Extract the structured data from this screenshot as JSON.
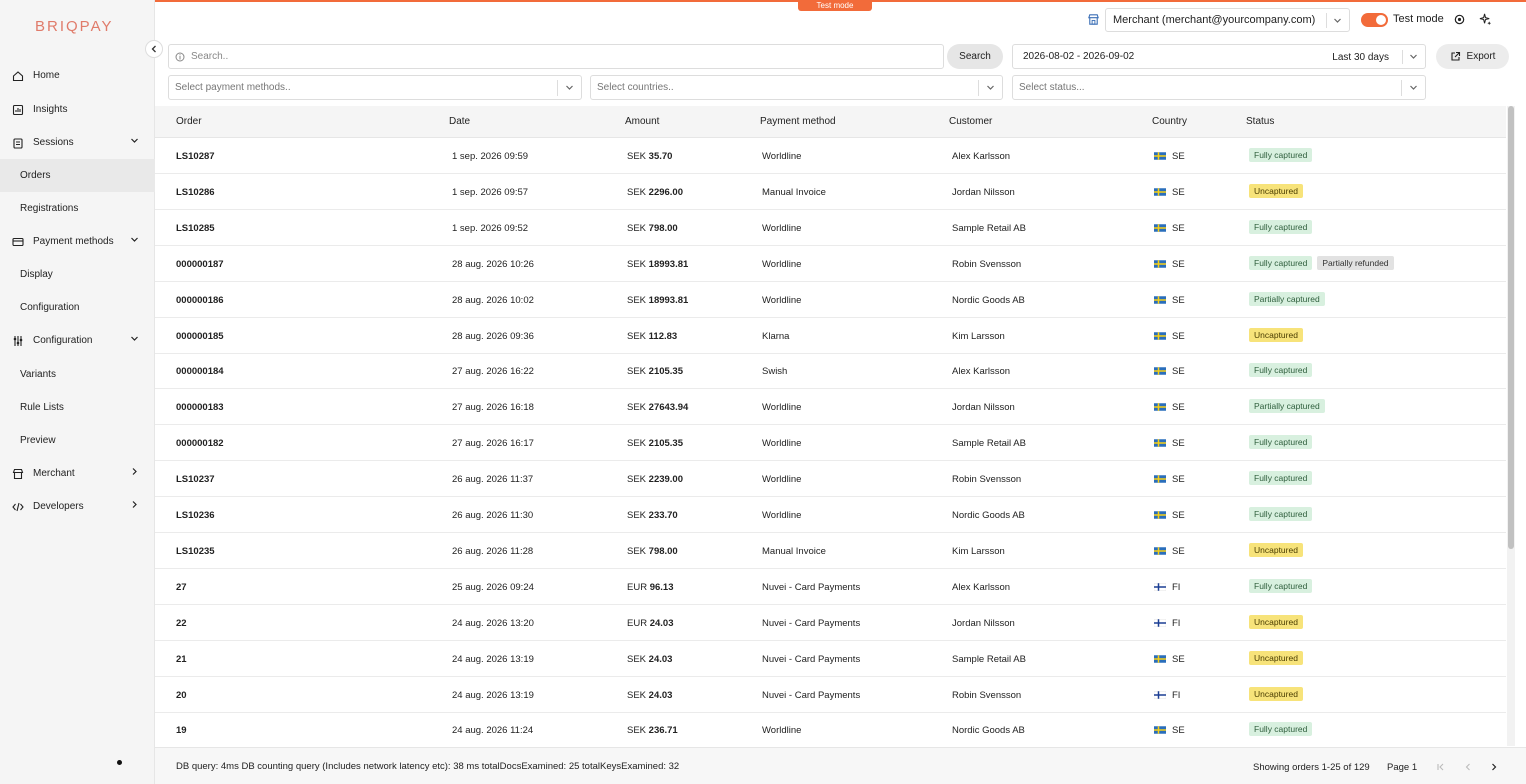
{
  "brand": "BRIQPAY",
  "sidebar": {
    "items": [
      {
        "label": "Home",
        "icon": "home-icon",
        "kind": "top"
      },
      {
        "label": "Insights",
        "icon": "insights-icon",
        "kind": "top"
      },
      {
        "label": "Sessions",
        "icon": "clipboard-icon",
        "kind": "top",
        "chevron": "down"
      },
      {
        "label": "Orders",
        "kind": "sub",
        "active": true
      },
      {
        "label": "Registrations",
        "kind": "sub"
      },
      {
        "label": "Payment methods",
        "icon": "card-icon",
        "kind": "top",
        "chevron": "down"
      },
      {
        "label": "Display",
        "kind": "sub"
      },
      {
        "label": "Configuration",
        "kind": "sub"
      },
      {
        "label": "Configuration",
        "icon": "sliders-icon",
        "kind": "top",
        "chevron": "down"
      },
      {
        "label": "Variants",
        "kind": "sub"
      },
      {
        "label": "Rule Lists",
        "kind": "sub"
      },
      {
        "label": "Preview",
        "kind": "sub"
      },
      {
        "label": "Merchant",
        "icon": "store-icon",
        "kind": "top",
        "chevron": "right"
      },
      {
        "label": "Developers",
        "icon": "code-icon",
        "kind": "top",
        "chevron": "right"
      }
    ]
  },
  "header": {
    "test_tab": "Test mode",
    "merchant": "Merchant (merchant@yourcompany.com)",
    "test_mode_label": "Test mode",
    "accent": "#f26b3a"
  },
  "filters": {
    "search_placeholder": "Search..",
    "search_button": "Search",
    "date_range": "2026-08-02 - 2026-09-02",
    "date_preset": "Last 30 days",
    "export_label": "Export",
    "payment_methods_placeholder": "Select payment methods..",
    "countries_placeholder": "Select countries..",
    "status_placeholder": "Select status..."
  },
  "table": {
    "columns": [
      "Order",
      "Date",
      "Amount",
      "Payment method",
      "Customer",
      "Country",
      "Status"
    ],
    "rows": [
      {
        "order": "LS10287",
        "date": "1 sep. 2026 09:59",
        "currency": "SEK",
        "amount": "35.70",
        "method": "Worldline",
        "customer": "Alex Karlsson",
        "country": "SE",
        "status": [
          {
            "label": "Fully captured",
            "tone": "green"
          }
        ]
      },
      {
        "order": "LS10286",
        "date": "1 sep. 2026 09:57",
        "currency": "SEK",
        "amount": "2296.00",
        "method": "Manual Invoice",
        "customer": "Jordan Nilsson",
        "country": "SE",
        "status": [
          {
            "label": "Uncaptured",
            "tone": "yellow"
          }
        ]
      },
      {
        "order": "LS10285",
        "date": "1 sep. 2026 09:52",
        "currency": "SEK",
        "amount": "798.00",
        "method": "Worldline",
        "customer": "Sample Retail AB",
        "country": "SE",
        "status": [
          {
            "label": "Fully captured",
            "tone": "green"
          }
        ]
      },
      {
        "order": "000000187",
        "date": "28 aug. 2026 10:26",
        "currency": "SEK",
        "amount": "18993.81",
        "method": "Worldline",
        "customer": "Robin Svensson",
        "country": "SE",
        "status": [
          {
            "label": "Fully captured",
            "tone": "green"
          },
          {
            "label": "Partially refunded",
            "tone": "grey"
          }
        ]
      },
      {
        "order": "000000186",
        "date": "28 aug. 2026 10:02",
        "currency": "SEK",
        "amount": "18993.81",
        "method": "Worldline",
        "customer": "Nordic Goods AB",
        "country": "SE",
        "status": [
          {
            "label": "Partially captured",
            "tone": "green"
          }
        ]
      },
      {
        "order": "000000185",
        "date": "28 aug. 2026 09:36",
        "currency": "SEK",
        "amount": "112.83",
        "method": "Klarna",
        "customer": "Kim Larsson",
        "country": "SE",
        "status": [
          {
            "label": "Uncaptured",
            "tone": "yellow"
          }
        ]
      },
      {
        "order": "000000184",
        "date": "27 aug. 2026 16:22",
        "currency": "SEK",
        "amount": "2105.35",
        "method": "Swish",
        "customer": "Alex Karlsson",
        "country": "SE",
        "status": [
          {
            "label": "Fully captured",
            "tone": "green"
          }
        ]
      },
      {
        "order": "000000183",
        "date": "27 aug. 2026 16:18",
        "currency": "SEK",
        "amount": "27643.94",
        "method": "Worldline",
        "customer": "Jordan Nilsson",
        "country": "SE",
        "status": [
          {
            "label": "Partially captured",
            "tone": "green"
          }
        ]
      },
      {
        "order": "000000182",
        "date": "27 aug. 2026 16:17",
        "currency": "SEK",
        "amount": "2105.35",
        "method": "Worldline",
        "customer": "Sample Retail AB",
        "country": "SE",
        "status": [
          {
            "label": "Fully captured",
            "tone": "green"
          }
        ]
      },
      {
        "order": "LS10237",
        "date": "26 aug. 2026 11:37",
        "currency": "SEK",
        "amount": "2239.00",
        "method": "Worldline",
        "customer": "Robin Svensson",
        "country": "SE",
        "status": [
          {
            "label": "Fully captured",
            "tone": "green"
          }
        ]
      },
      {
        "order": "LS10236",
        "date": "26 aug. 2026 11:30",
        "currency": "SEK",
        "amount": "233.70",
        "method": "Worldline",
        "customer": "Nordic Goods AB",
        "country": "SE",
        "status": [
          {
            "label": "Fully captured",
            "tone": "green"
          }
        ]
      },
      {
        "order": "LS10235",
        "date": "26 aug. 2026 11:28",
        "currency": "SEK",
        "amount": "798.00",
        "method": "Manual Invoice",
        "customer": "Kim Larsson",
        "country": "SE",
        "status": [
          {
            "label": "Uncaptured",
            "tone": "yellow"
          }
        ]
      },
      {
        "order": "27",
        "date": "25 aug. 2026 09:24",
        "currency": "EUR",
        "amount": "96.13",
        "method": "Nuvei - Card Payments",
        "customer": "Alex Karlsson",
        "country": "FI",
        "status": [
          {
            "label": "Fully captured",
            "tone": "green"
          }
        ]
      },
      {
        "order": "22",
        "date": "24 aug. 2026 13:20",
        "currency": "EUR",
        "amount": "24.03",
        "method": "Nuvei - Card Payments",
        "customer": "Jordan Nilsson",
        "country": "FI",
        "status": [
          {
            "label": "Uncaptured",
            "tone": "yellow"
          }
        ]
      },
      {
        "order": "21",
        "date": "24 aug. 2026 13:19",
        "currency": "SEK",
        "amount": "24.03",
        "method": "Nuvei - Card Payments",
        "customer": "Sample Retail AB",
        "country": "SE",
        "status": [
          {
            "label": "Uncaptured",
            "tone": "yellow"
          }
        ]
      },
      {
        "order": "20",
        "date": "24 aug. 2026 13:19",
        "currency": "SEK",
        "amount": "24.03",
        "method": "Nuvei - Card Payments",
        "customer": "Robin Svensson",
        "country": "FI",
        "status": [
          {
            "label": "Uncaptured",
            "tone": "yellow"
          }
        ]
      },
      {
        "order": "19",
        "date": "24 aug. 2026 11:24",
        "currency": "SEK",
        "amount": "236.71",
        "method": "Worldline",
        "customer": "Nordic Goods AB",
        "country": "SE",
        "status": [
          {
            "label": "Fully captured",
            "tone": "green"
          }
        ]
      }
    ]
  },
  "footer": {
    "stats": "DB query: 4ms  DB counting query (Includes network latency etc): 38 ms  totalDocsExamined: 25  totalKeysExamined: 32",
    "showing": "Showing orders 1-25 of 129",
    "page": "Page 1"
  }
}
